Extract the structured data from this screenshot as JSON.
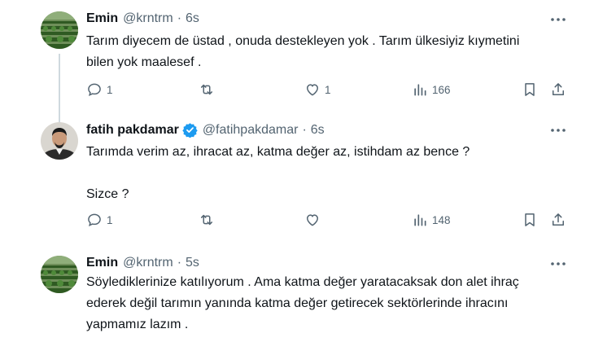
{
  "tweets": [
    {
      "name": "Emin",
      "handle": "@krntrm",
      "dot": "·",
      "time": "6s",
      "verified": false,
      "text": "Tarım diyecem de üstad , onuda destekleyen yok . Tarım ülkesiyiz kıymetini\nbilen yok maalesef .",
      "replies": "1",
      "reposts": "",
      "likes": "1",
      "views": "166"
    },
    {
      "name": "fatih pakdamar",
      "handle": "@fatihpakdamar",
      "dot": "·",
      "time": "6s",
      "verified": true,
      "text": "Tarımda verim az, ihracat az, katma değer az, istihdam az bence ?\n\nSizce ?",
      "replies": "1",
      "reposts": "",
      "likes": "",
      "views": "148"
    },
    {
      "name": "Emin",
      "handle": "@krntrm",
      "dot": "·",
      "time": "5s",
      "verified": false,
      "text": "Söylediklerinize katılıyorum . Ama katma değer  yaratacaksak don alet ihraç\nederek değil tarımın yanında katma değer getirecek sektörlerinde ihracını\nyapmamız lazım ."
    }
  ],
  "icons": {
    "reply": "reply-icon",
    "repost": "repost-icon",
    "like": "heart-icon",
    "views": "views-chart-icon",
    "bookmark": "bookmark-icon",
    "share": "share-icon",
    "more": "more-dots-icon",
    "verified": "verified-badge-icon"
  },
  "colors": {
    "text": "#0f1419",
    "secondary": "#536471",
    "verified": "#1d9bf0",
    "thread_line": "#cfd9de"
  }
}
